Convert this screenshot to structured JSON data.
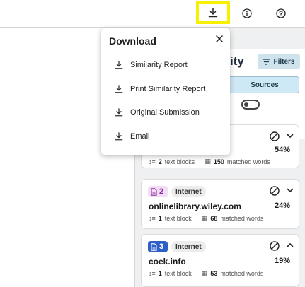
{
  "toolbar": {
    "download_icon": "download-icon",
    "info_icon": "info-icon",
    "help_icon": "help-icon",
    "highlight_color": "#f7f100"
  },
  "panel": {
    "title_fragment": "ity",
    "filters_label": "Filters",
    "tab_sources_label": "Sources"
  },
  "download_menu": {
    "title": "Download",
    "items": [
      {
        "label": "Similarity Report",
        "icon": "download-icon"
      },
      {
        "label": "Print Similarity Report",
        "icon": "download-icon"
      },
      {
        "label": "Original Submission",
        "icon": "download-icon"
      },
      {
        "label": "Email",
        "icon": "download-icon"
      }
    ]
  },
  "sources": [
    {
      "number": "",
      "type": "",
      "name": "",
      "percent": "54%",
      "text_blocks": "2",
      "text_blocks_label": "text blocks",
      "matched_words": "150",
      "matched_words_label": "matched words"
    },
    {
      "number": "2",
      "type": "Internet",
      "name": "onlinelibrary.wiley.com",
      "percent": "24%",
      "text_blocks": "1",
      "text_blocks_label": "text block",
      "matched_words": "68",
      "matched_words_label": "matched words",
      "tag_color": "#f3dcf6",
      "tag_text_color": "#8a2c9a"
    },
    {
      "number": "3",
      "type": "Internet",
      "name": "coek.info",
      "percent": "19%",
      "text_blocks": "1",
      "text_blocks_label": "text block",
      "matched_words": "53",
      "matched_words_label": "matched words",
      "tag_color": "#2f5fc9",
      "tag_text_color": "#ffffff"
    }
  ]
}
